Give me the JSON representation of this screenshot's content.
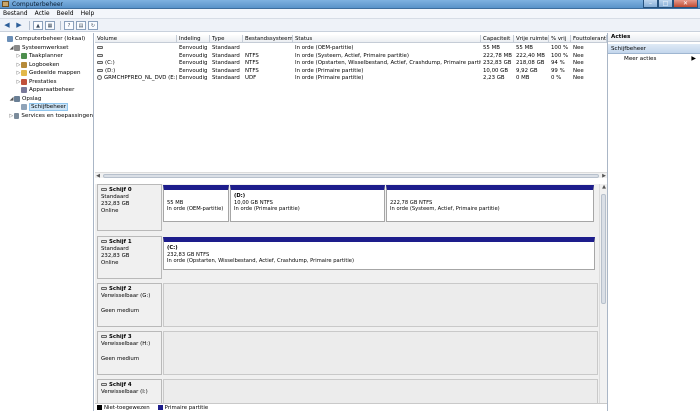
{
  "window": {
    "title": "Computerbeheer",
    "buttons": {
      "minimize": "–",
      "maximize": "□",
      "close": "✕"
    }
  },
  "menu": [
    "Bestand",
    "Actie",
    "Beeld",
    "Help"
  ],
  "tree": {
    "items": [
      {
        "label": "Computerbeheer (lokaal)",
        "indent": 0,
        "expander": "",
        "icon": "computer-icon",
        "selected": false
      },
      {
        "label": "Systeemwerkset",
        "indent": 1,
        "expander": "◢",
        "icon": "tools-icon",
        "selected": false
      },
      {
        "label": "Taakplanner",
        "indent": 2,
        "expander": "▷",
        "icon": "clock-icon",
        "selected": false
      },
      {
        "label": "Logboeken",
        "indent": 2,
        "expander": "▷",
        "icon": "log-icon",
        "selected": false
      },
      {
        "label": "Gedeelde mappen",
        "indent": 2,
        "expander": "▷",
        "icon": "folder-icon",
        "selected": false
      },
      {
        "label": "Prestaties",
        "indent": 2,
        "expander": "▷",
        "icon": "performance-icon",
        "selected": false
      },
      {
        "label": "Apparaatbeheer",
        "indent": 2,
        "expander": "",
        "icon": "device-icon",
        "selected": false
      },
      {
        "label": "Opslag",
        "indent": 1,
        "expander": "◢",
        "icon": "storage-icon",
        "selected": false
      },
      {
        "label": "Schijfbeheer",
        "indent": 2,
        "expander": "",
        "icon": "disk-icon",
        "selected": true
      },
      {
        "label": "Services en toepassingen",
        "indent": 1,
        "expander": "▷",
        "icon": "services-icon",
        "selected": false
      }
    ]
  },
  "volumes": {
    "columns": [
      "Volume",
      "Indeling",
      "Type",
      "Bestandssysteem",
      "Status",
      "Capaciteit",
      "Vrije ruimte",
      "% vrij",
      "Fouttolerantie"
    ],
    "rows": [
      {
        "volume": "",
        "layout": "Eenvoudig",
        "type": "Standaard",
        "fs": "",
        "status": "In orde (OEM-partitie)",
        "capacity": "55 MB",
        "free": "55 MB",
        "pct": "100 %",
        "fault": "Nee",
        "icon": "disk-icon"
      },
      {
        "volume": "",
        "layout": "Eenvoudig",
        "type": "Standaard",
        "fs": "NTFS",
        "status": "In orde (Systeem, Actief, Primaire partitie)",
        "capacity": "222,78 MB",
        "free": "222,40 MB",
        "pct": "100 %",
        "fault": "Nee",
        "icon": "disk-icon"
      },
      {
        "volume": "(C:)",
        "layout": "Eenvoudig",
        "type": "Standaard",
        "fs": "NTFS",
        "status": "In orde (Opstarten, Wisselbestand, Actief, Crashdump, Primaire partitie)",
        "capacity": "232,83 GB",
        "free": "218,08 GB",
        "pct": "94 %",
        "fault": "Nee",
        "icon": "disk-icon"
      },
      {
        "volume": "(D:)",
        "layout": "Eenvoudig",
        "type": "Standaard",
        "fs": "NTFS",
        "status": "In orde (Primaire partitie)",
        "capacity": "10,00 GB",
        "free": "9,92 GB",
        "pct": "99 %",
        "fault": "Nee",
        "icon": "disk-icon"
      },
      {
        "volume": "GRMCHPFREO_NL_DVD (E:)",
        "layout": "Eenvoudig",
        "type": "Standaard",
        "fs": "UDF",
        "status": "In orde (Primaire partitie)",
        "capacity": "2,23 GB",
        "free": "0 MB",
        "pct": "0 %",
        "fault": "Nee",
        "icon": "cd-icon"
      }
    ]
  },
  "disks": [
    {
      "name": "Schijf 0",
      "kind": "Standaard",
      "size": "232,83 GB",
      "state": "Online",
      "partitions": [
        {
          "name": "",
          "size": "55 MB",
          "status": "In orde (OEM-partitie)"
        },
        {
          "name": "(D:)",
          "size": "10,00 GB NTFS",
          "status": "In orde (Primaire partitie)"
        },
        {
          "name": "",
          "size": "222,78 GB NTFS",
          "status": "In orde (Systeem, Actief, Primaire partitie)"
        }
      ]
    },
    {
      "name": "Schijf 1",
      "kind": "Standaard",
      "size": "232,83 GB",
      "state": "Online",
      "partitions": [
        {
          "name": "(C:)",
          "size": "232,83 GB NTFS",
          "status": "In orde (Opstarten, Wisselbestand, Actief, Crashdump, Primaire partitie)"
        }
      ]
    },
    {
      "name": "Schijf 2",
      "kind": "Verwisselbaar (G:)",
      "size": "",
      "state": "Geen medium",
      "partitions": []
    },
    {
      "name": "Schijf 3",
      "kind": "Verwisselbaar (H:)",
      "size": "",
      "state": "Geen medium",
      "partitions": []
    },
    {
      "name": "Schijf 4",
      "kind": "Verwisselbaar (I:)",
      "size": "",
      "state": "",
      "partitions": []
    }
  ],
  "legend": [
    {
      "label": "Niet-toegewezen",
      "color": "#000000"
    },
    {
      "label": "Primaire partitie",
      "color": "#1d1d8c"
    }
  ],
  "actions": {
    "header": "Acties",
    "section": "Schijfbeheer",
    "more": "Meer acties"
  }
}
